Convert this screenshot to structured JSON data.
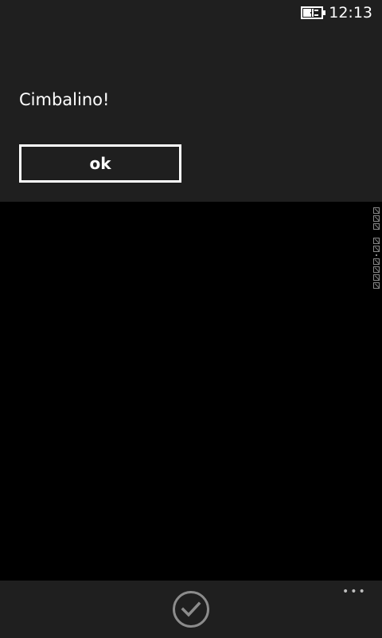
{
  "status_bar": {
    "time": "12:13",
    "battery_icon": "battery-charging-icon"
  },
  "message_box": {
    "text": "Cimbalino!",
    "ok_label": "ok"
  },
  "app_bar": {
    "primary_icon": "check-icon",
    "more_label": "•••"
  },
  "colors": {
    "panel": "#1f1f1f",
    "background": "#000000",
    "foreground": "#ffffff"
  }
}
